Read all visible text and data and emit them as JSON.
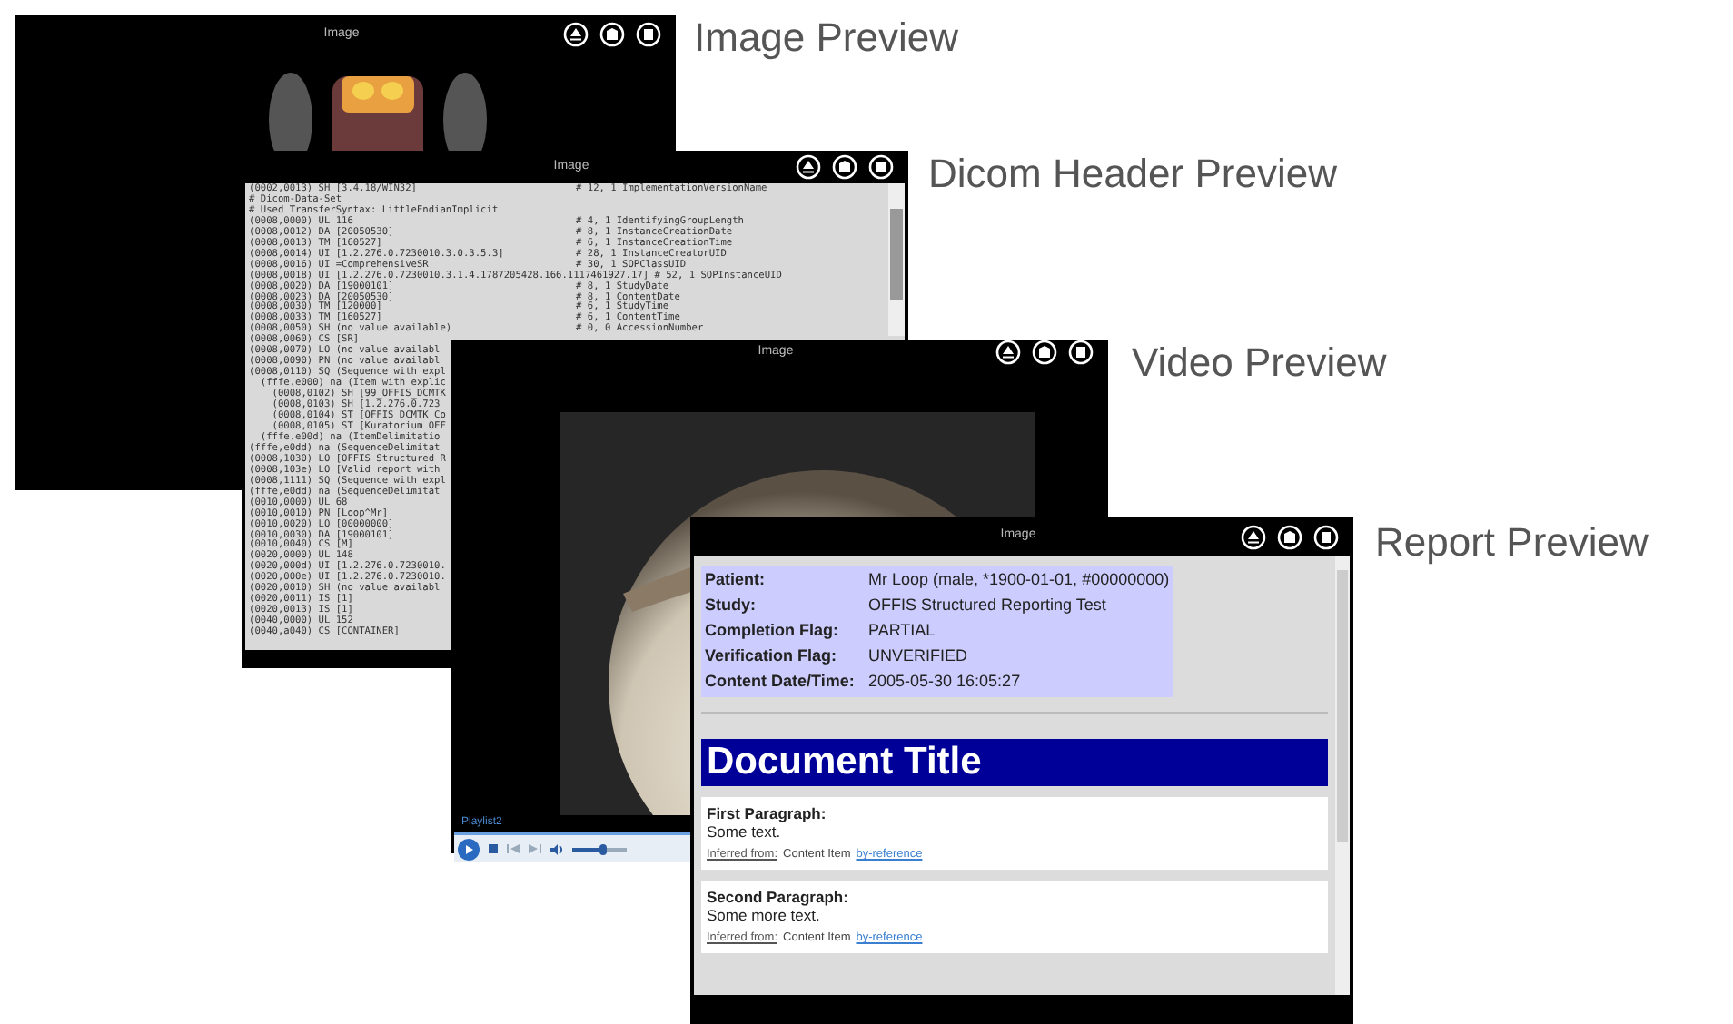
{
  "previews": [
    {
      "kind": "image",
      "title": "Image",
      "caption": "Image Preview"
    },
    {
      "kind": "dicom",
      "title": "Image",
      "caption": "Dicom Header Preview",
      "lines": [
        {
          "text": "(0002,0013) SH [3.4.18/WIN32]",
          "comment": "# 12, 1 ImplementationVersionName"
        },
        {
          "text": "# Dicom-Data-Set"
        },
        {
          "text": "# Used TransferSyntax: LittleEndianImplicit"
        },
        {
          "text": "(0008,0000) UL 116",
          "comment": "# 4, 1 IdentifyingGroupLength"
        },
        {
          "text": "(0008,0012) DA [20050530]",
          "comment": "# 8, 1 InstanceCreationDate"
        },
        {
          "text": "(0008,0013) TM [160527]",
          "comment": "# 6, 1 InstanceCreationTime"
        },
        {
          "text": "(0008,0014) UI [1.2.276.0.7230010.3.0.3.5.3]",
          "comment": "# 28, 1 InstanceCreatorUID"
        },
        {
          "text": "(0008,0016) UI =ComprehensiveSR",
          "comment": "# 30, 1 SOPClassUID"
        },
        {
          "text": "(0008,0018) UI [1.2.276.0.7230010.3.1.4.1787205428.166.1117461927.17] # 52, 1 SOPInstanceUID"
        },
        {
          "text": "(0008,0020) DA [19000101]",
          "comment": "# 8, 1 StudyDate"
        },
        {
          "text": "(0008,0023) DA [20050530]",
          "comment": "# 8, 1 ContentDate"
        },
        {
          "text": "(0008,0030) TM [120000]",
          "comment": "# 6, 1 StudyTime"
        },
        {
          "text": "(0008,0033) TM [160527]",
          "comment": "# 6, 1 ContentTime"
        },
        {
          "text": "(0008,0050) SH (no value available)",
          "comment": "# 0, 0 AccessionNumber"
        },
        {
          "text": "(0008,0060) CS [SR]"
        },
        {
          "text": "(0008,0070) LO (no value availabl"
        },
        {
          "text": "(0008,0090) PN (no value availabl"
        },
        {
          "text": "(0008,0110) SQ (Sequence with expl"
        },
        {
          "text": "  (fffe,e000) na (Item with explic"
        },
        {
          "text": "    (0008,0102) SH [99_OFFIS_DCMTK"
        },
        {
          "text": "    (0008,0103) SH [1.2.276.0.723"
        },
        {
          "text": "    (0008,0104) ST [OFFIS DCMTK Co"
        },
        {
          "text": "    (0008,0105) ST [Kuratorium OFF"
        },
        {
          "text": "  (fffe,e00d) na (ItemDelimitatio"
        },
        {
          "text": "(fffe,e0dd) na (SequenceDelimitat"
        },
        {
          "text": "(0008,1030) LO [OFFIS Structured R"
        },
        {
          "text": "(0008,103e) LO [Valid report with"
        },
        {
          "text": "(0008,1111) SQ (Sequence with expl"
        },
        {
          "text": "(fffe,e0dd) na (SequenceDelimitat"
        },
        {
          "text": "(0010,0000) UL 68"
        },
        {
          "text": "(0010,0010) PN [Loop^Mr]"
        },
        {
          "text": "(0010,0020) LO [00000000]"
        },
        {
          "text": "(0010,0030) DA [19000101]"
        },
        {
          "text": "(0010,0040) CS [M]"
        },
        {
          "text": "(0020,0000) UL 148"
        },
        {
          "text": "(0020,000d) UI [1.2.276.0.7230010."
        },
        {
          "text": "(0020,000e) UI [1.2.276.0.7230010."
        },
        {
          "text": "(0020,0010) SH (no value availabl"
        },
        {
          "text": "(0020,0011) IS [1]"
        },
        {
          "text": "(0020,0013) IS [1]"
        },
        {
          "text": "(0040,0000) UL 152"
        },
        {
          "text": "(0040,a040) CS [CONTAINER]"
        }
      ]
    },
    {
      "kind": "video",
      "title": "Image",
      "caption": "Video Preview",
      "playlist": "Playlist2",
      "volume": {
        "level": 0.55
      }
    },
    {
      "kind": "report",
      "title": "Image",
      "caption": "Report Preview",
      "fields": [
        {
          "label": "Patient:",
          "value": "Mr Loop (male, *1900-01-01, #00000000)"
        },
        {
          "label": "Study:",
          "value": "OFFIS Structured Reporting Test"
        },
        {
          "label": "Completion Flag:",
          "value": "PARTIAL"
        },
        {
          "label": "Verification Flag:",
          "value": "UNVERIFIED"
        },
        {
          "label": "Content Date/Time:",
          "value": "2005-05-30 16:05:27"
        }
      ],
      "document_title": "Document Title",
      "paragraphs": [
        {
          "heading": "First Paragraph:",
          "text": "Some text.",
          "inferred": "Inferred from:",
          "item": "Content Item",
          "link": "by-reference"
        },
        {
          "heading": "Second Paragraph:",
          "text": "Some more text.",
          "inferred": "Inferred from:",
          "item": "Content Item",
          "link": "by-reference"
        }
      ]
    }
  ]
}
